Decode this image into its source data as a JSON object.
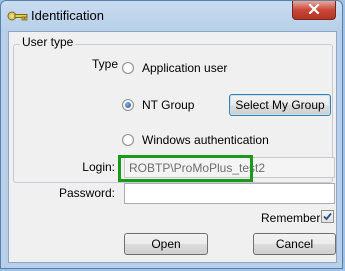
{
  "window": {
    "title": "Identification",
    "close_glyph": "✕"
  },
  "user_type": {
    "group_title": "User type",
    "type_label": "Type",
    "options": [
      {
        "label": "Application user",
        "checked": false
      },
      {
        "label": "NT Group",
        "checked": true
      },
      {
        "label": "Windows authentication",
        "checked": false
      }
    ],
    "select_group_button": "Select My Group"
  },
  "credentials": {
    "login_label": "Login:",
    "login_value": "ROBTP\\ProMoPlus_test2",
    "password_label": "Password:",
    "password_value": ""
  },
  "remember": {
    "label": "Remember",
    "checked": true
  },
  "buttons": {
    "open": "Open",
    "cancel": "Cancel"
  },
  "colors": {
    "highlight": "#1a9a1a",
    "radio_selected": "#1d4d9c",
    "close_button": "#c9463a"
  }
}
